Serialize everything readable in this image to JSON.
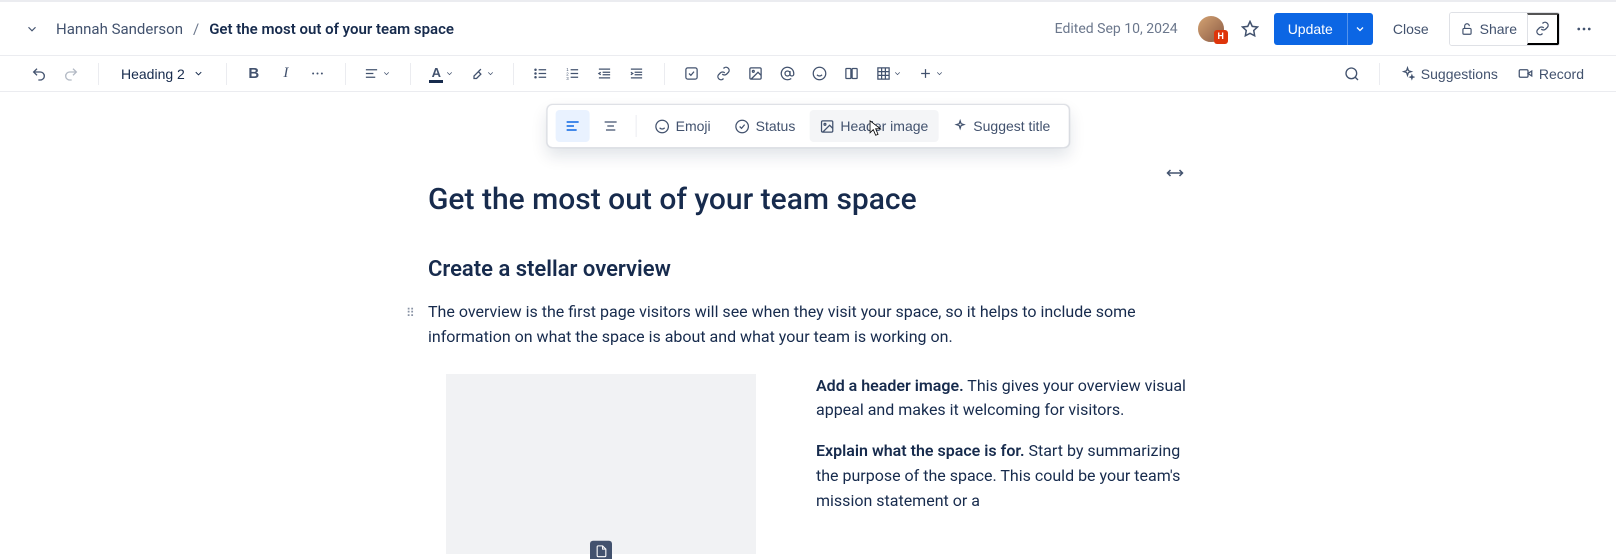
{
  "header": {
    "breadcrumb_user": "Hannah Sanderson",
    "breadcrumb_title": "Get the most out of your team space",
    "edited_label": "Edited Sep 10, 2024",
    "avatar_badge": "H",
    "update_label": "Update",
    "close_label": "Close",
    "share_label": "Share"
  },
  "toolbar": {
    "style_label": "Heading 2",
    "suggestions_label": "Suggestions",
    "record_label": "Record"
  },
  "floatbar": {
    "emoji": "Emoji",
    "status": "Status",
    "header_image": "Header image",
    "suggest_title": "Suggest title"
  },
  "doc": {
    "title": "Get the most out of your team space",
    "h2_1": "Create a stellar overview",
    "p1": "The overview is the first page visitors will see when they visit your space, so it helps to include some information on what the space is about and what your team is working on.",
    "tip1_b": "Add a header image.",
    "tip1_t": " This gives your overview visual appeal and makes it welcoming for visitors.",
    "tip2_b": "Explain what the space is for.",
    "tip2_t": " Start by summarizing the purpose of the space. This could be your team's mission statement or a"
  },
  "colors": {
    "primary": "#0C66E4"
  }
}
